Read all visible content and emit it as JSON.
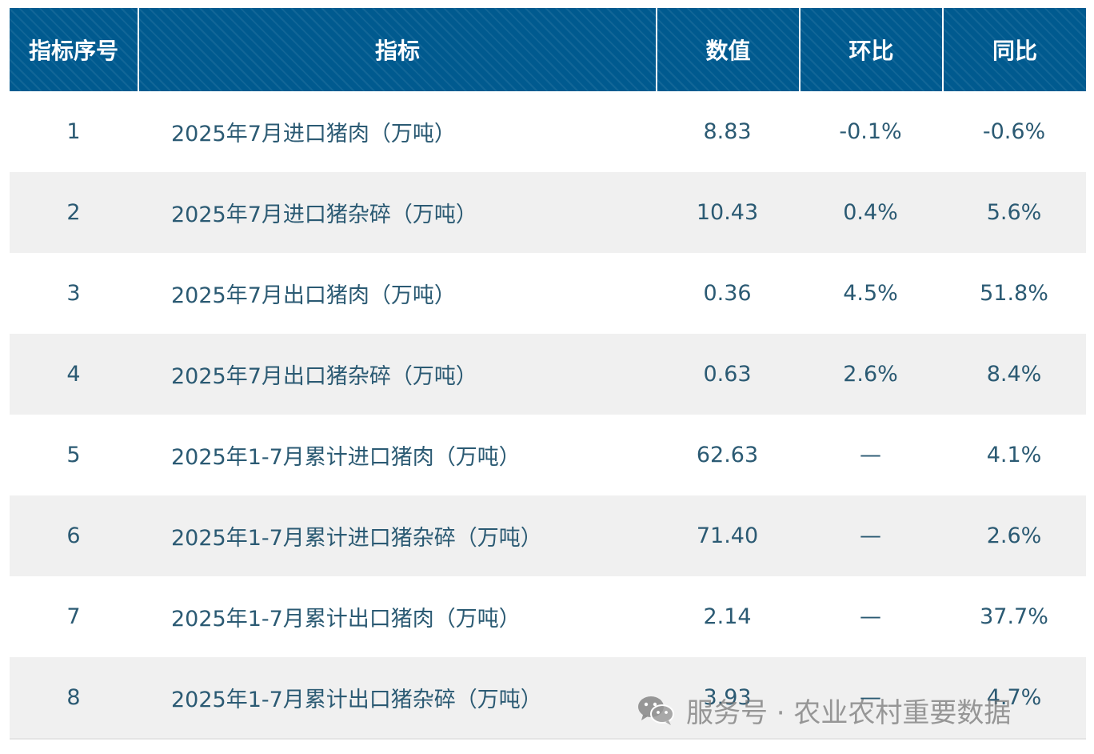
{
  "table": {
    "headers": [
      "指标序号",
      "指标",
      "数值",
      "环比",
      "同比"
    ],
    "rows": [
      {
        "id": "1",
        "name": "2025年7月进口猪肉（万吨）",
        "value": "8.83",
        "mom": "-0.1%",
        "yoy": "-0.6%"
      },
      {
        "id": "2",
        "name": "2025年7月进口猪杂碎（万吨）",
        "value": "10.43",
        "mom": "0.4%",
        "yoy": "5.6%"
      },
      {
        "id": "3",
        "name": "2025年7月出口猪肉（万吨）",
        "value": "0.36",
        "mom": "4.5%",
        "yoy": "51.8%"
      },
      {
        "id": "4",
        "name": "2025年7月出口猪杂碎（万吨）",
        "value": "0.63",
        "mom": "2.6%",
        "yoy": "8.4%"
      },
      {
        "id": "5",
        "name": "2025年1-7月累计进口猪肉（万吨）",
        "value": "62.63",
        "mom": "—",
        "yoy": "4.1%"
      },
      {
        "id": "6",
        "name": "2025年1-7月累计进口猪杂碎（万吨）",
        "value": "71.40",
        "mom": "—",
        "yoy": "2.6%"
      },
      {
        "id": "7",
        "name": "2025年1-7月累计出口猪肉（万吨）",
        "value": "2.14",
        "mom": "—",
        "yoy": "37.7%"
      },
      {
        "id": "8",
        "name": "2025年1-7月累计出口猪杂碎（万吨）",
        "value": "3.93",
        "mom": "—",
        "yoy": "4.7%"
      }
    ]
  },
  "watermark": {
    "text": "服务号 · 农业农村重要数据",
    "icon": "wechat-icon"
  },
  "colors": {
    "header_bg": "#005a8f",
    "header_text": "#ffffff",
    "body_text": "#2b5a73",
    "alt_row_bg": "#f0f0f0"
  }
}
